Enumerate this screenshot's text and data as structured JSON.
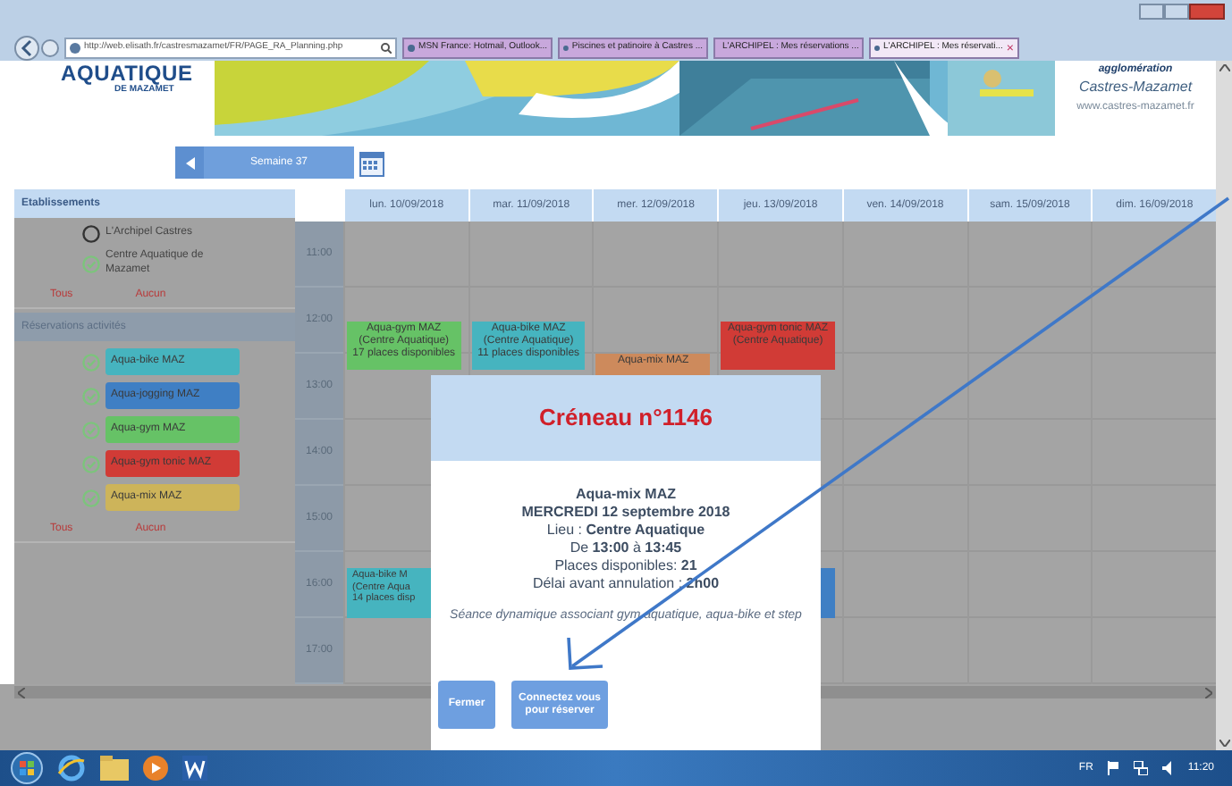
{
  "browser": {
    "address": "http://web.elisath.fr/castresmazamet/FR/PAGE_RA_Planning.php",
    "tabs": [
      {
        "label": "MSN France: Hotmail, Outlook...",
        "selected": false
      },
      {
        "label": "Piscines et patinoire à Castres ...",
        "selected": false
      },
      {
        "label": "L'ARCHIPEL : Mes réservations ...",
        "selected": false
      },
      {
        "label": "L'ARCHIPEL : Mes réservati...",
        "selected": true,
        "close": "×"
      }
    ]
  },
  "banner": {
    "logo_title": "AQUATIQUE",
    "logo_subtitle": "DE MAZAMET",
    "partner_line1": "agglomération",
    "partner_line2": "Castres-Mazamet",
    "website": "www.castres-mazamet.fr"
  },
  "week_nav": {
    "label": "Semaine 37"
  },
  "sidebar": {
    "sections": [
      {
        "title": "Etablissements",
        "items": [
          {
            "label": "L'Archipel Castres",
            "checked": false
          },
          {
            "label": "Centre Aquatique de Mazamet",
            "checked": true
          }
        ],
        "all": "Tous",
        "none": "Aucun"
      },
      {
        "title": "Réservations activités",
        "items": [
          {
            "label": "Aqua-bike MAZ",
            "checked": true,
            "color": "#46b4bf"
          },
          {
            "label": "Aqua-jogging MAZ",
            "checked": true,
            "color": "#3f7fc4"
          },
          {
            "label": "Aqua-gym MAZ",
            "checked": true,
            "color": "#66c266"
          },
          {
            "label": "Aqua-gym tonic MAZ",
            "checked": true,
            "color": "#d13b36"
          },
          {
            "label": "Aqua-mix MAZ",
            "checked": true,
            "color": "#cdb45a"
          }
        ],
        "all": "Tous",
        "none": "Aucun"
      }
    ]
  },
  "calendar": {
    "times": [
      "11:00",
      "12:00",
      "13:00",
      "14:00",
      "15:00",
      "16:00",
      "17:00"
    ],
    "days": [
      {
        "label": "lun. 10/09/2018",
        "events": [
          {
            "color": "#66c266",
            "lines": [
              "Aqua-gym MAZ",
              "(Centre Aquatique)",
              "17 places disponibles"
            ]
          },
          {
            "color": "#46b4bf",
            "lines": [
              "Aqua-bike M",
              "(Centre Aqua",
              "14 places disp"
            ]
          }
        ]
      },
      {
        "label": "mar. 11/09/2018",
        "events": [
          {
            "color": "#46b4bf",
            "lines": [
              "Aqua-bike MAZ",
              "(Centre Aquatique)",
              "11 places disponibles"
            ]
          }
        ]
      },
      {
        "label": "mer. 12/09/2018",
        "events": [
          {
            "color": "#cd8a5c",
            "lines": [
              "Aqua-mix MAZ"
            ]
          }
        ]
      },
      {
        "label": "jeu. 13/09/2018",
        "events": [
          {
            "color": "#d13b36",
            "lines": [
              "Aqua-gym tonic MAZ",
              "(Centre Aquatique)"
            ]
          },
          {
            "color": "#3f7fc4"
          }
        ]
      },
      {
        "label": "ven. 14/09/2018"
      },
      {
        "label": "sam. 15/09/2018"
      },
      {
        "label": "dim. 16/09/2018"
      }
    ]
  },
  "modal": {
    "title": "Créneau n°1146",
    "activity": "Aqua-mix MAZ",
    "date": "MERCREDI 12 septembre 2018",
    "details": [
      "Lieu : **Centre Aquatique**",
      "De **13:00** à **13:45**",
      "Places disponibles: **21**",
      "Délai avant annulation : **2h00**"
    ],
    "description": "Séance dynamique associant gym aquatique, aqua-bike et step",
    "buttons": [
      "Fermer",
      "Connectez vous pour réserver"
    ]
  },
  "taskbar": {
    "language": "FR",
    "clock": "11:20"
  }
}
